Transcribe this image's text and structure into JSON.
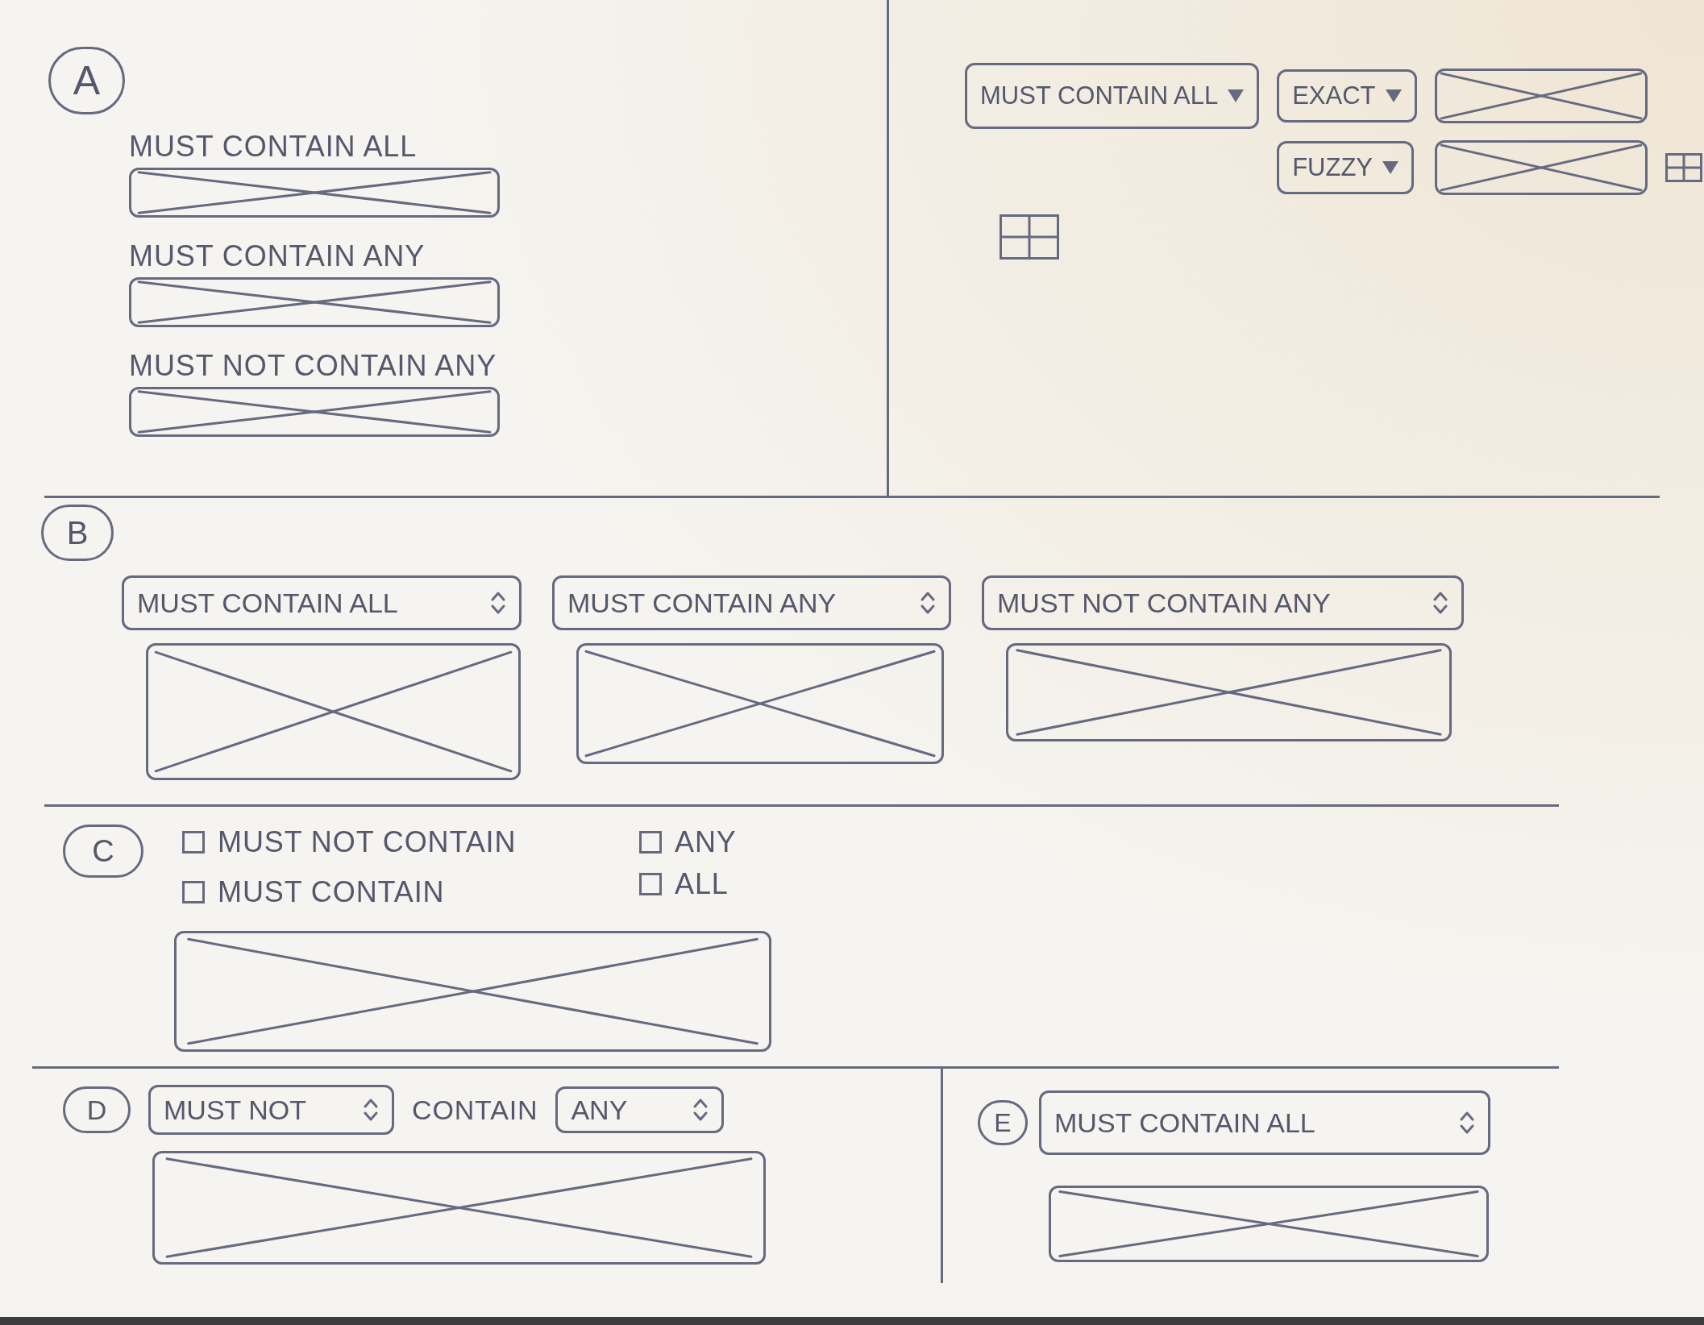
{
  "section_a": {
    "badge": "A",
    "fields": [
      {
        "label": "MUST CONTAIN ALL"
      },
      {
        "label": "MUST CONTAIN ANY"
      },
      {
        "label": "MUST NOT CONTAIN ANY"
      }
    ]
  },
  "top_right_panel": {
    "rows": [
      {
        "selects": [
          "MUST CONTAIN ALL",
          "EXACT"
        ]
      },
      {
        "selects": [
          "FUZZY"
        ]
      }
    ]
  },
  "section_b": {
    "badge": "B",
    "columns": [
      {
        "select": "MUST CONTAIN ALL"
      },
      {
        "select": "MUST CONTAIN ANY"
      },
      {
        "select": "MUST NOT CONTAIN ANY"
      }
    ]
  },
  "section_c": {
    "badge": "C",
    "conditions": [
      {
        "label": "MUST NOT CONTAIN",
        "checked": false
      },
      {
        "label": "MUST CONTAIN",
        "checked": false
      }
    ],
    "quantifiers": [
      {
        "label": "ANY",
        "checked": false
      },
      {
        "label": "ALL",
        "checked": false
      }
    ]
  },
  "section_d": {
    "badge": "D",
    "parts": [
      {
        "kind": "select",
        "text": "MUST NOT"
      },
      {
        "kind": "text",
        "text": "CONTAIN"
      },
      {
        "kind": "select",
        "text": "ANY"
      }
    ]
  },
  "section_e": {
    "badge": "E",
    "select": "MUST CONTAIN ALL"
  }
}
